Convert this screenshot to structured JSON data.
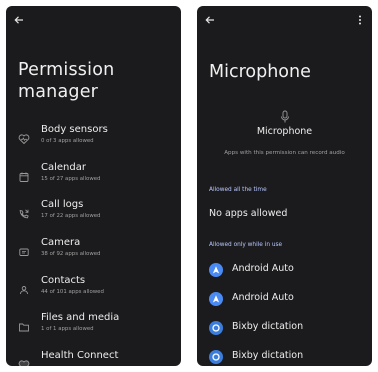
{
  "left": {
    "title": "Permission manager",
    "permissions": [
      {
        "label": "Body sensors",
        "sub": "0 of 3 apps allowed",
        "icon": "heart-pulse-icon"
      },
      {
        "label": "Calendar",
        "sub": "15 of 27 apps allowed",
        "icon": "calendar-icon"
      },
      {
        "label": "Call logs",
        "sub": "17 of 22 apps allowed",
        "icon": "call-log-icon"
      },
      {
        "label": "Camera",
        "sub": "38 of 92 apps allowed",
        "icon": "camera-icon"
      },
      {
        "label": "Contacts",
        "sub": "44 of 101 apps allowed",
        "icon": "contacts-icon"
      },
      {
        "label": "Files and media",
        "sub": "1 of 1 apps allowed",
        "icon": "folder-icon"
      },
      {
        "label": "Health Connect",
        "sub": "",
        "icon": "health-connect-icon"
      }
    ]
  },
  "right": {
    "title": "Microphone",
    "permission_name": "Microphone",
    "description": "Apps with this permission can record audio",
    "section_always": "Allowed all the time",
    "no_apps": "No apps allowed",
    "section_while_in_use": "Allowed only while in use",
    "apps": [
      {
        "label": "Android Auto",
        "icon": "android-auto-icon",
        "color": "#4a8af4"
      },
      {
        "label": "Android Auto",
        "icon": "android-auto-icon",
        "color": "#4a8af4"
      },
      {
        "label": "Bixby dictation",
        "icon": "bixby-icon",
        "color": "#3b7ddd"
      },
      {
        "label": "Bixby dictation",
        "icon": "bixby-icon",
        "color": "#3b7ddd"
      }
    ]
  }
}
